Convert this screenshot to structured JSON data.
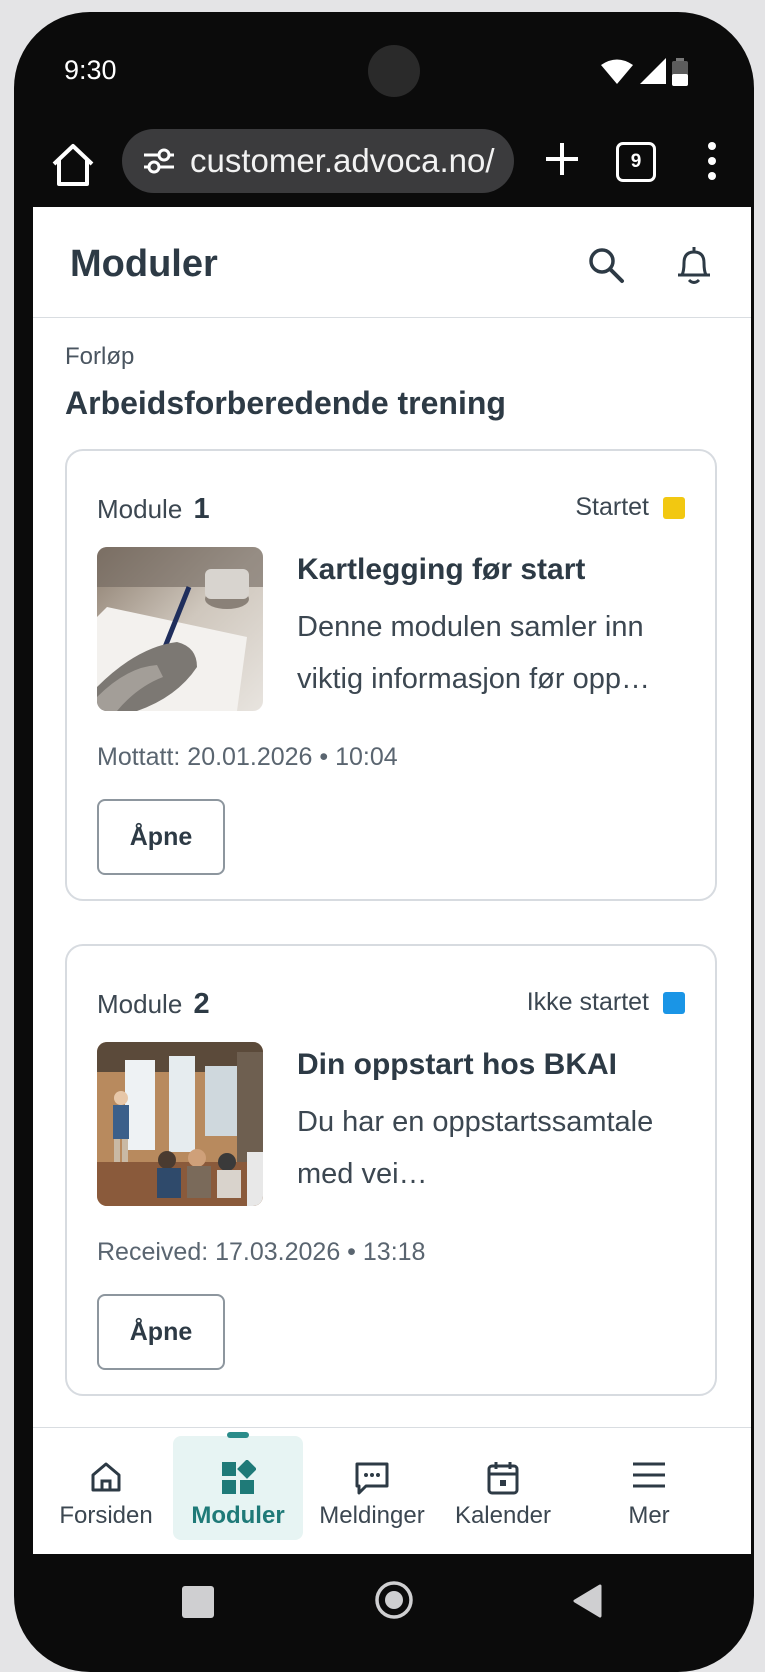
{
  "status_bar": {
    "time": "9:30"
  },
  "browser": {
    "url": "customer.advoca.no/",
    "tab_count": "9"
  },
  "header": {
    "title": "Moduler"
  },
  "course": {
    "label": "Forløp",
    "title": "Arbeidsforberedende trening"
  },
  "modules": [
    {
      "label": "Module",
      "number": "1",
      "status": "Startet",
      "status_color": "#f2c811",
      "title": "Kartlegging før start",
      "description": "Denne modulen samler inn viktig informasjon før opp…",
      "received": "Mottatt: 20.01.2026 • 10:04",
      "button": "Åpne"
    },
    {
      "label": "Module",
      "number": "2",
      "status": "Ikke startet",
      "status_color": "#1a95e6",
      "title": "Din oppstart hos BKAI",
      "description": "Du har en oppstartssamtale med vei…",
      "received": "Received: 17.03.2026 • 13:18",
      "button": "Åpne"
    }
  ],
  "bottom_nav": [
    {
      "label": "Forsiden",
      "icon": "home-icon"
    },
    {
      "label": "Moduler",
      "icon": "modules-icon",
      "active": true
    },
    {
      "label": "Meldinger",
      "icon": "message-icon"
    },
    {
      "label": "Kalender",
      "icon": "calendar-icon"
    },
    {
      "label": "Mer",
      "icon": "menu-icon"
    }
  ],
  "colors": {
    "accent": "#1f7a78",
    "active_bg": "#e7f4f3",
    "text": "#2d3a45"
  }
}
